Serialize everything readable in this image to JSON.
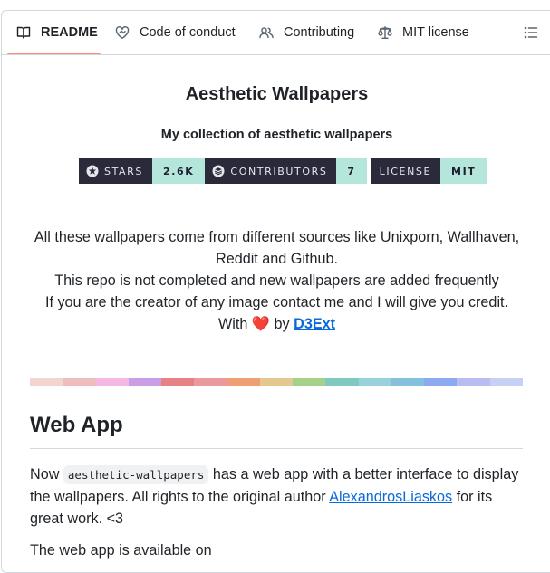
{
  "tabs": [
    {
      "label": "README",
      "icon": "book-icon",
      "active": true
    },
    {
      "label": "Code of conduct",
      "icon": "code-of-conduct-icon",
      "active": false
    },
    {
      "label": "Contributing",
      "icon": "people-icon",
      "active": false
    },
    {
      "label": "MIT license",
      "icon": "law-icon",
      "active": false
    }
  ],
  "outline_icon": "list-unordered-icon",
  "readme": {
    "title": "Aesthetic Wallpapers",
    "subtitle": "My collection of aesthetic wallpapers",
    "badges": [
      {
        "label": "STARS",
        "value": "2.6K",
        "icon": "star-burst-icon"
      },
      {
        "label": "CONTRIBUTORS",
        "value": "7",
        "icon": "layers-icon"
      },
      {
        "label": "LICENSE",
        "value": "MIT",
        "icon": ""
      }
    ],
    "intro": {
      "line1": "All these wallpapers come from different sources like Unixporn, Wallhaven, Reddit and Github.",
      "line2": "This repo is not completed and new wallpapers are added frequently",
      "line3": "If you are the creator of any image contact me and I will give you credit.",
      "line4_prefix": "With",
      "heart": "❤️",
      "line4_by": "by",
      "author_link": "D3Ext"
    },
    "palette_colors": [
      "#f2d5cf",
      "#eebebe",
      "#f4b8e4",
      "#ca9ee6",
      "#e78284",
      "#ea999c",
      "#ef9f76",
      "#e5c890",
      "#a6d189",
      "#81c8be",
      "#99d1db",
      "#85c1dc",
      "#8caaee",
      "#babbf1",
      "#c6d0f5"
    ],
    "webapp": {
      "heading": "Web App",
      "text_before_code": "Now",
      "code": "aesthetic-wallpapers",
      "text_after_code": "has a web app with a better interface to display the wallpapers. All rights to the original author",
      "author_link": "AlexandrosLiaskos",
      "text_end": "for its great work. <3",
      "next_line": "The web app is available on"
    }
  }
}
